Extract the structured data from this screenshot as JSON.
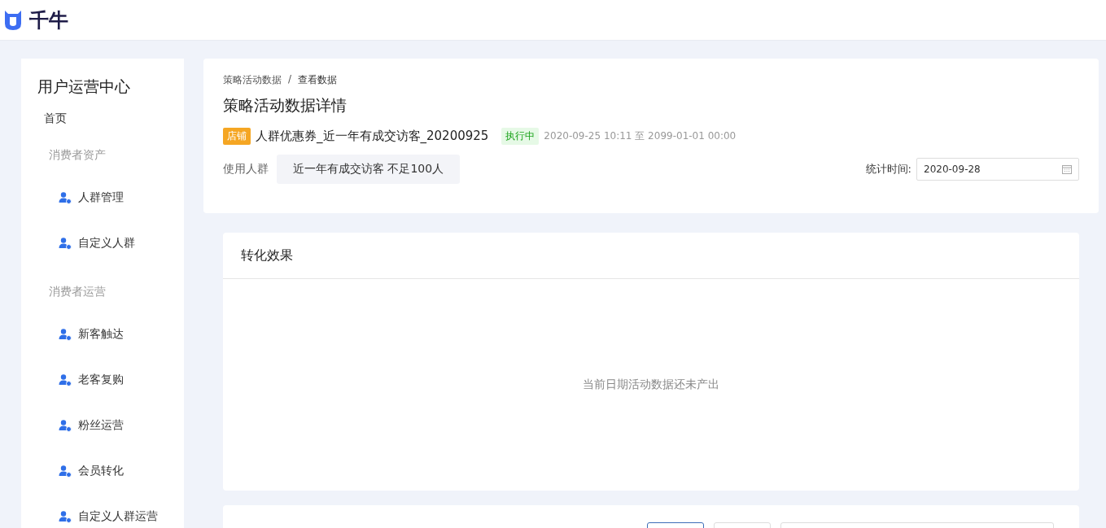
{
  "header": {
    "logo_text": "千牛"
  },
  "sidebar": {
    "title": "用户运营中心",
    "items": [
      {
        "kind": "link",
        "label": "首页"
      },
      {
        "kind": "group",
        "label": "消费者资产"
      },
      {
        "kind": "item",
        "label": "人群管理"
      },
      {
        "kind": "item",
        "label": "自定义人群"
      },
      {
        "kind": "group",
        "label": "消费者运营"
      },
      {
        "kind": "item",
        "label": "新客触达"
      },
      {
        "kind": "item",
        "label": "老客复购"
      },
      {
        "kind": "item",
        "label": "粉丝运营"
      },
      {
        "kind": "item",
        "label": "会员转化"
      },
      {
        "kind": "item",
        "label": "自定义人群运营"
      }
    ]
  },
  "breadcrumb": [
    "策略活动数据",
    "/",
    "查看数据"
  ],
  "page_title": "策略活动数据详情",
  "activity": {
    "tag": "店铺",
    "name": "人群优惠券_近一年有成交访客_20200925",
    "status": "执行中",
    "period": "2020-09-25 10:11 至 2099-01-01 00:00"
  },
  "audience": {
    "label": "使用人群",
    "value": "近一年有成交访客 不足100人"
  },
  "stat_time": {
    "label": "统计时间:",
    "value": "2020-09-28"
  },
  "conversion": {
    "title": "转化效果",
    "empty_text": "当前日期活动数据还未产出"
  },
  "bottom_controls": [
    {
      "kind": "button",
      "selected": true
    },
    {
      "kind": "button",
      "selected": false
    },
    {
      "kind": "field"
    }
  ]
}
